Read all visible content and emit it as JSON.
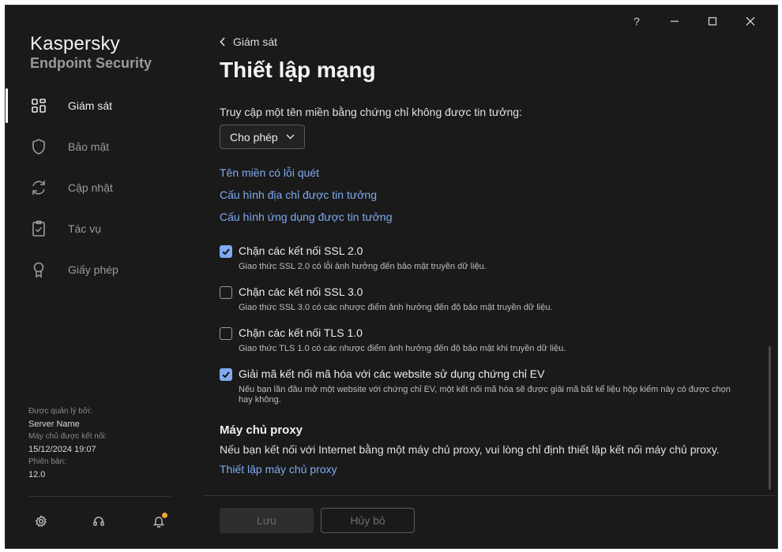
{
  "window": {
    "help_label": "?"
  },
  "sidebar": {
    "brand_name": "Kaspersky",
    "brand_product": "Endpoint Security",
    "items": [
      {
        "label": "Giám sát",
        "icon": "dashboard-grid-icon",
        "active": true
      },
      {
        "label": "Bảo mật",
        "icon": "shield-icon",
        "active": false
      },
      {
        "label": "Cập nhật",
        "icon": "refresh-icon",
        "active": false
      },
      {
        "label": "Tác vụ",
        "icon": "clipboard-check-icon",
        "active": false
      },
      {
        "label": "Giấy phép",
        "icon": "license-ribbon-icon",
        "active": false
      }
    ],
    "meta": {
      "managed_by_label": "Được quản lý bởi:",
      "managed_by_value": "Server Name",
      "server_conn_label": "Máy chủ được kết nối:",
      "server_conn_value": "15/12/2024 19:07",
      "version_label": "Phiên bản:",
      "version_value": "12.0"
    },
    "bottom_icons": [
      "settings-gear-icon",
      "headset-support-icon",
      "bell-notification-icon"
    ]
  },
  "main": {
    "back_label": "Giám sát",
    "title": "Thiết lập mạng",
    "untrusted_question": "Truy cập một tên miền bằng chứng chỉ không được tin tưởng:",
    "untrusted_select_value": "Cho phép",
    "links": {
      "scan_error_domains": "Tên miền có lỗi quét",
      "trusted_addresses": "Cấu hình địa chỉ được tin tưởng",
      "trusted_apps": "Cấu hình ứng dụng được tin tưởng"
    },
    "options": [
      {
        "label": "Chặn các kết nối SSL 2.0",
        "desc": "Giao thức SSL 2.0 có lỗi ảnh hưởng đến bảo mật truyền dữ liệu.",
        "checked": true
      },
      {
        "label": "Chặn các kết nối SSL 3.0",
        "desc": "Giao thức SSL 3.0 có các nhược điểm ảnh hưởng đến độ bảo mật truyền dữ liệu.",
        "checked": false
      },
      {
        "label": "Chặn các kết nối TLS 1.0",
        "desc": "Giao thức TLS 1.0 có các nhược điểm ảnh hưởng đến độ bảo mật khi truyền dữ liệu.",
        "checked": false
      },
      {
        "label": "Giải mã kết nối mã hóa với các website sử dụng chứng chỉ EV",
        "desc": "Nếu bạn lần đầu mở một website với chứng chỉ EV, một kết nối mã hóa sẽ được giải mã bất kể liệu hộp kiểm này có được chọn hay không.",
        "checked": true
      }
    ],
    "proxy": {
      "heading": "Máy chủ proxy",
      "description": "Nếu bạn kết nối với Internet bằng một máy chủ proxy, vui lòng chỉ định thiết lập kết nối máy chủ proxy.",
      "link": "Thiết lập máy chủ proxy"
    },
    "footer": {
      "save_label": "Lưu",
      "cancel_label": "Hủy bỏ"
    }
  },
  "colors": {
    "accent": "#7faaf0",
    "background": "#1a1a1a",
    "notification": "#f0a830"
  }
}
